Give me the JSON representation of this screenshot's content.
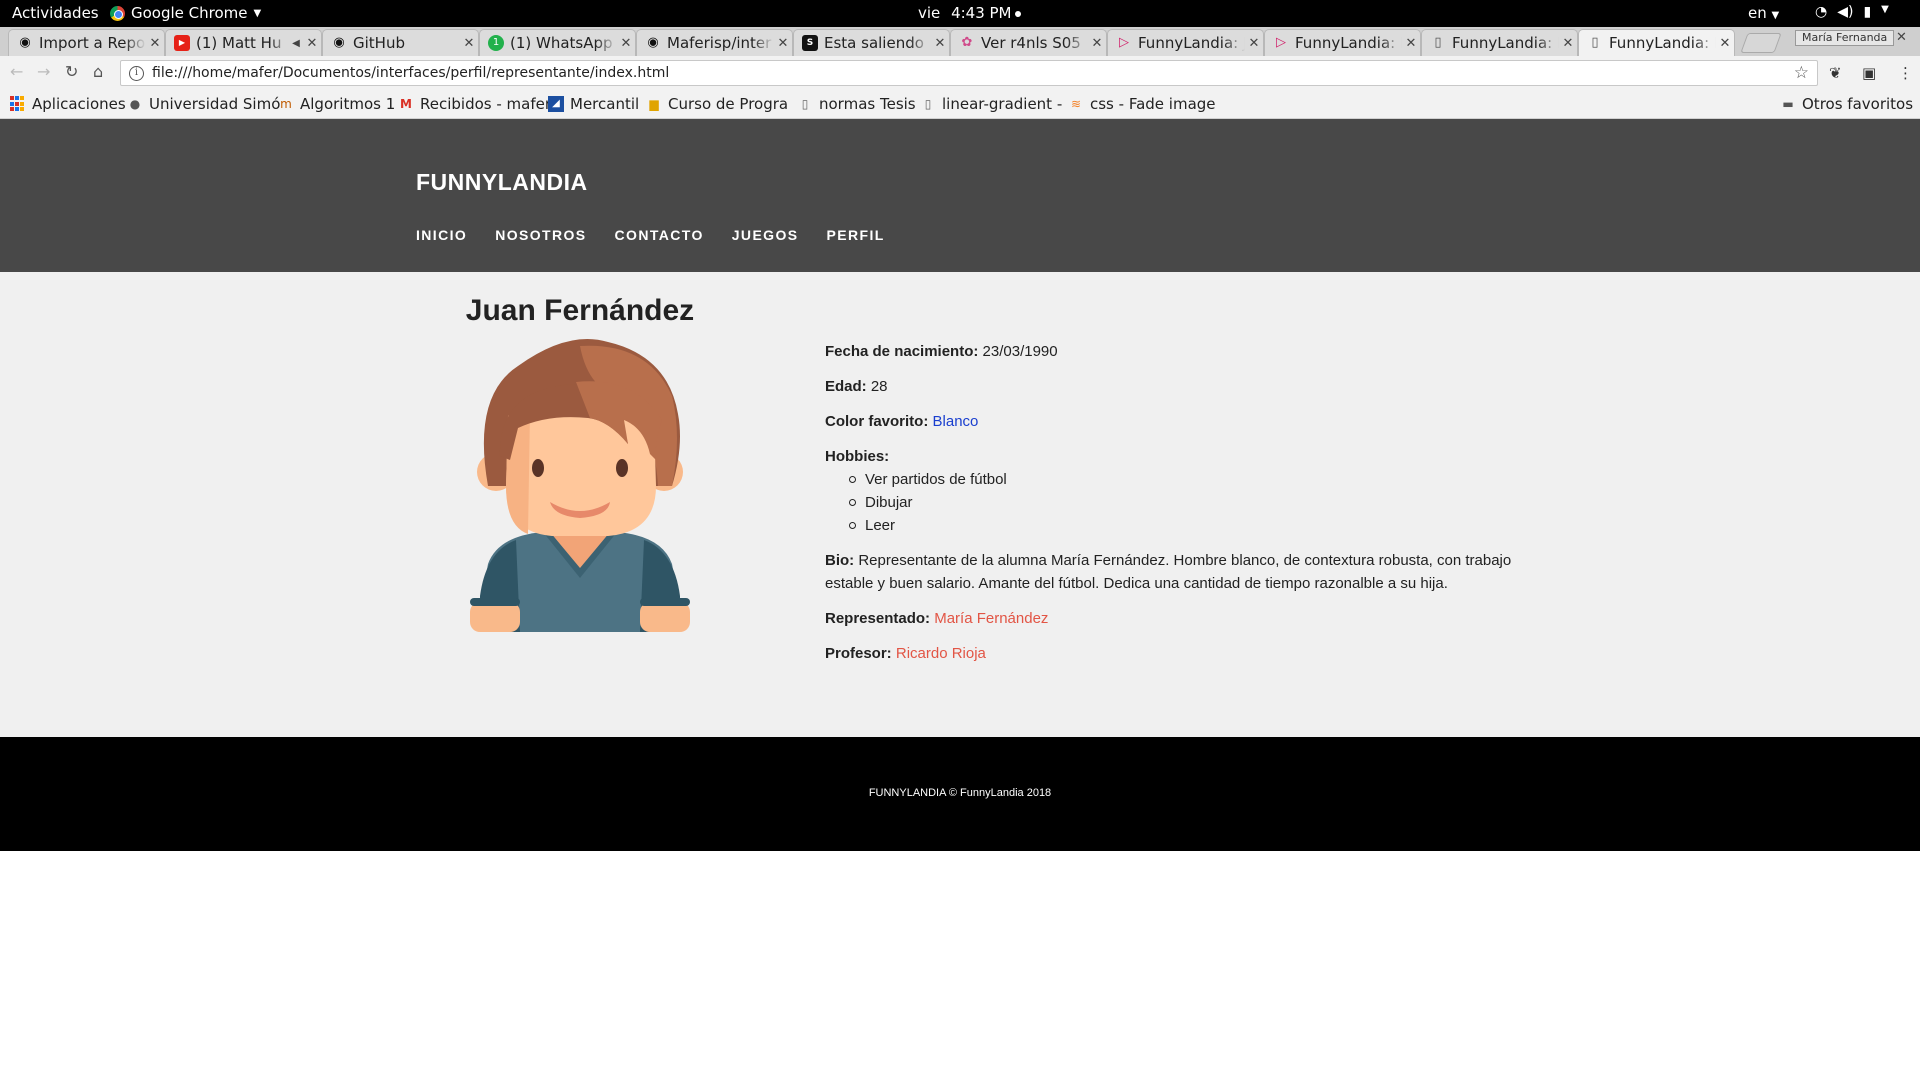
{
  "system": {
    "activities": "Actividades",
    "app_name": "Google Chrome",
    "clock_day": "vie",
    "clock_time": "4:43 PM",
    "language": "en"
  },
  "browser": {
    "tabs": [
      {
        "label": "Import a Repo",
        "icon": "github-icon"
      },
      {
        "label": "(1) Matt Hu",
        "icon": "youtube-icon"
      },
      {
        "label": "GitHub",
        "icon": "github-icon"
      },
      {
        "label": "(1) WhatsApp",
        "icon": "whatsapp-icon"
      },
      {
        "label": "Maferisp/inter",
        "icon": "github-icon"
      },
      {
        "label": "Esta saliendo",
        "icon": "s-site-icon"
      },
      {
        "label": "Ver r4nls S05",
        "icon": "r4nls-icon"
      },
      {
        "label": "FunnyLandia: J",
        "icon": "funnylandia-icon"
      },
      {
        "label": "FunnyLandia: I",
        "icon": "funnylandia-icon"
      },
      {
        "label": "FunnyLandia: I",
        "icon": "document-icon"
      },
      {
        "label": "FunnyLandia: I",
        "icon": "document-icon",
        "active": true
      }
    ],
    "profile_name": "María Fernanda",
    "url": "file:///home/mafer/Documentos/interfaces/perfil/representante/index.html",
    "bookmarks": [
      {
        "label": "Aplicaciones",
        "icon": "apps-grid-icon"
      },
      {
        "label": "Universidad Simó",
        "icon": "university-icon"
      },
      {
        "label": "Algoritmos 1",
        "icon": "algoritmos-icon"
      },
      {
        "label": "Recibidos - mafer",
        "icon": "gmail-icon"
      },
      {
        "label": "Mercantil",
        "icon": "mercantil-icon"
      },
      {
        "label": "Curso de Progra",
        "icon": "course-icon"
      },
      {
        "label": "normas Tesis",
        "icon": "document-icon"
      },
      {
        "label": "linear-gradient -",
        "icon": "document-icon"
      },
      {
        "label": "css - Fade image",
        "icon": "stackoverflow-icon"
      }
    ],
    "other_bookmarks": "Otros favoritos"
  },
  "site": {
    "brand": "FUNNYLANDIA",
    "nav": [
      "INICIO",
      "NOSOTROS",
      "CONTACTO",
      "JUEGOS",
      "PERFIL"
    ],
    "footer": "FUNNYLANDIA © FunnyLandia 2018"
  },
  "profile": {
    "name": "Juan Fernández",
    "birth_label": "Fecha de nacimiento:",
    "birth_value": "23/03/1990",
    "age_label": "Edad:",
    "age_value": "28",
    "color_label": "Color favorito:",
    "color_value": "Blanco",
    "hobbies_label": "Hobbies:",
    "hobbies": [
      "Ver partidos de fútbol",
      "Dibujar",
      "Leer"
    ],
    "bio_label": "Bio:",
    "bio_value": "Representante de la alumna María Fernández. Hombre blanco, de contextura robusta, con trabajo estable y buen salario. Amante del fútbol. Dedica una cantidad de tiempo razonalble a su hija.",
    "represented_label": "Representado:",
    "represented_value": "María Fernández",
    "teacher_label": "Profesor:",
    "teacher_value": "Ricardo Rioja"
  },
  "colors": {
    "header_bg": "#484848",
    "content_bg": "#f0f0f0",
    "footer_bg": "#000000",
    "link_blue": "#1a3fcf",
    "link_red": "#e25545"
  }
}
